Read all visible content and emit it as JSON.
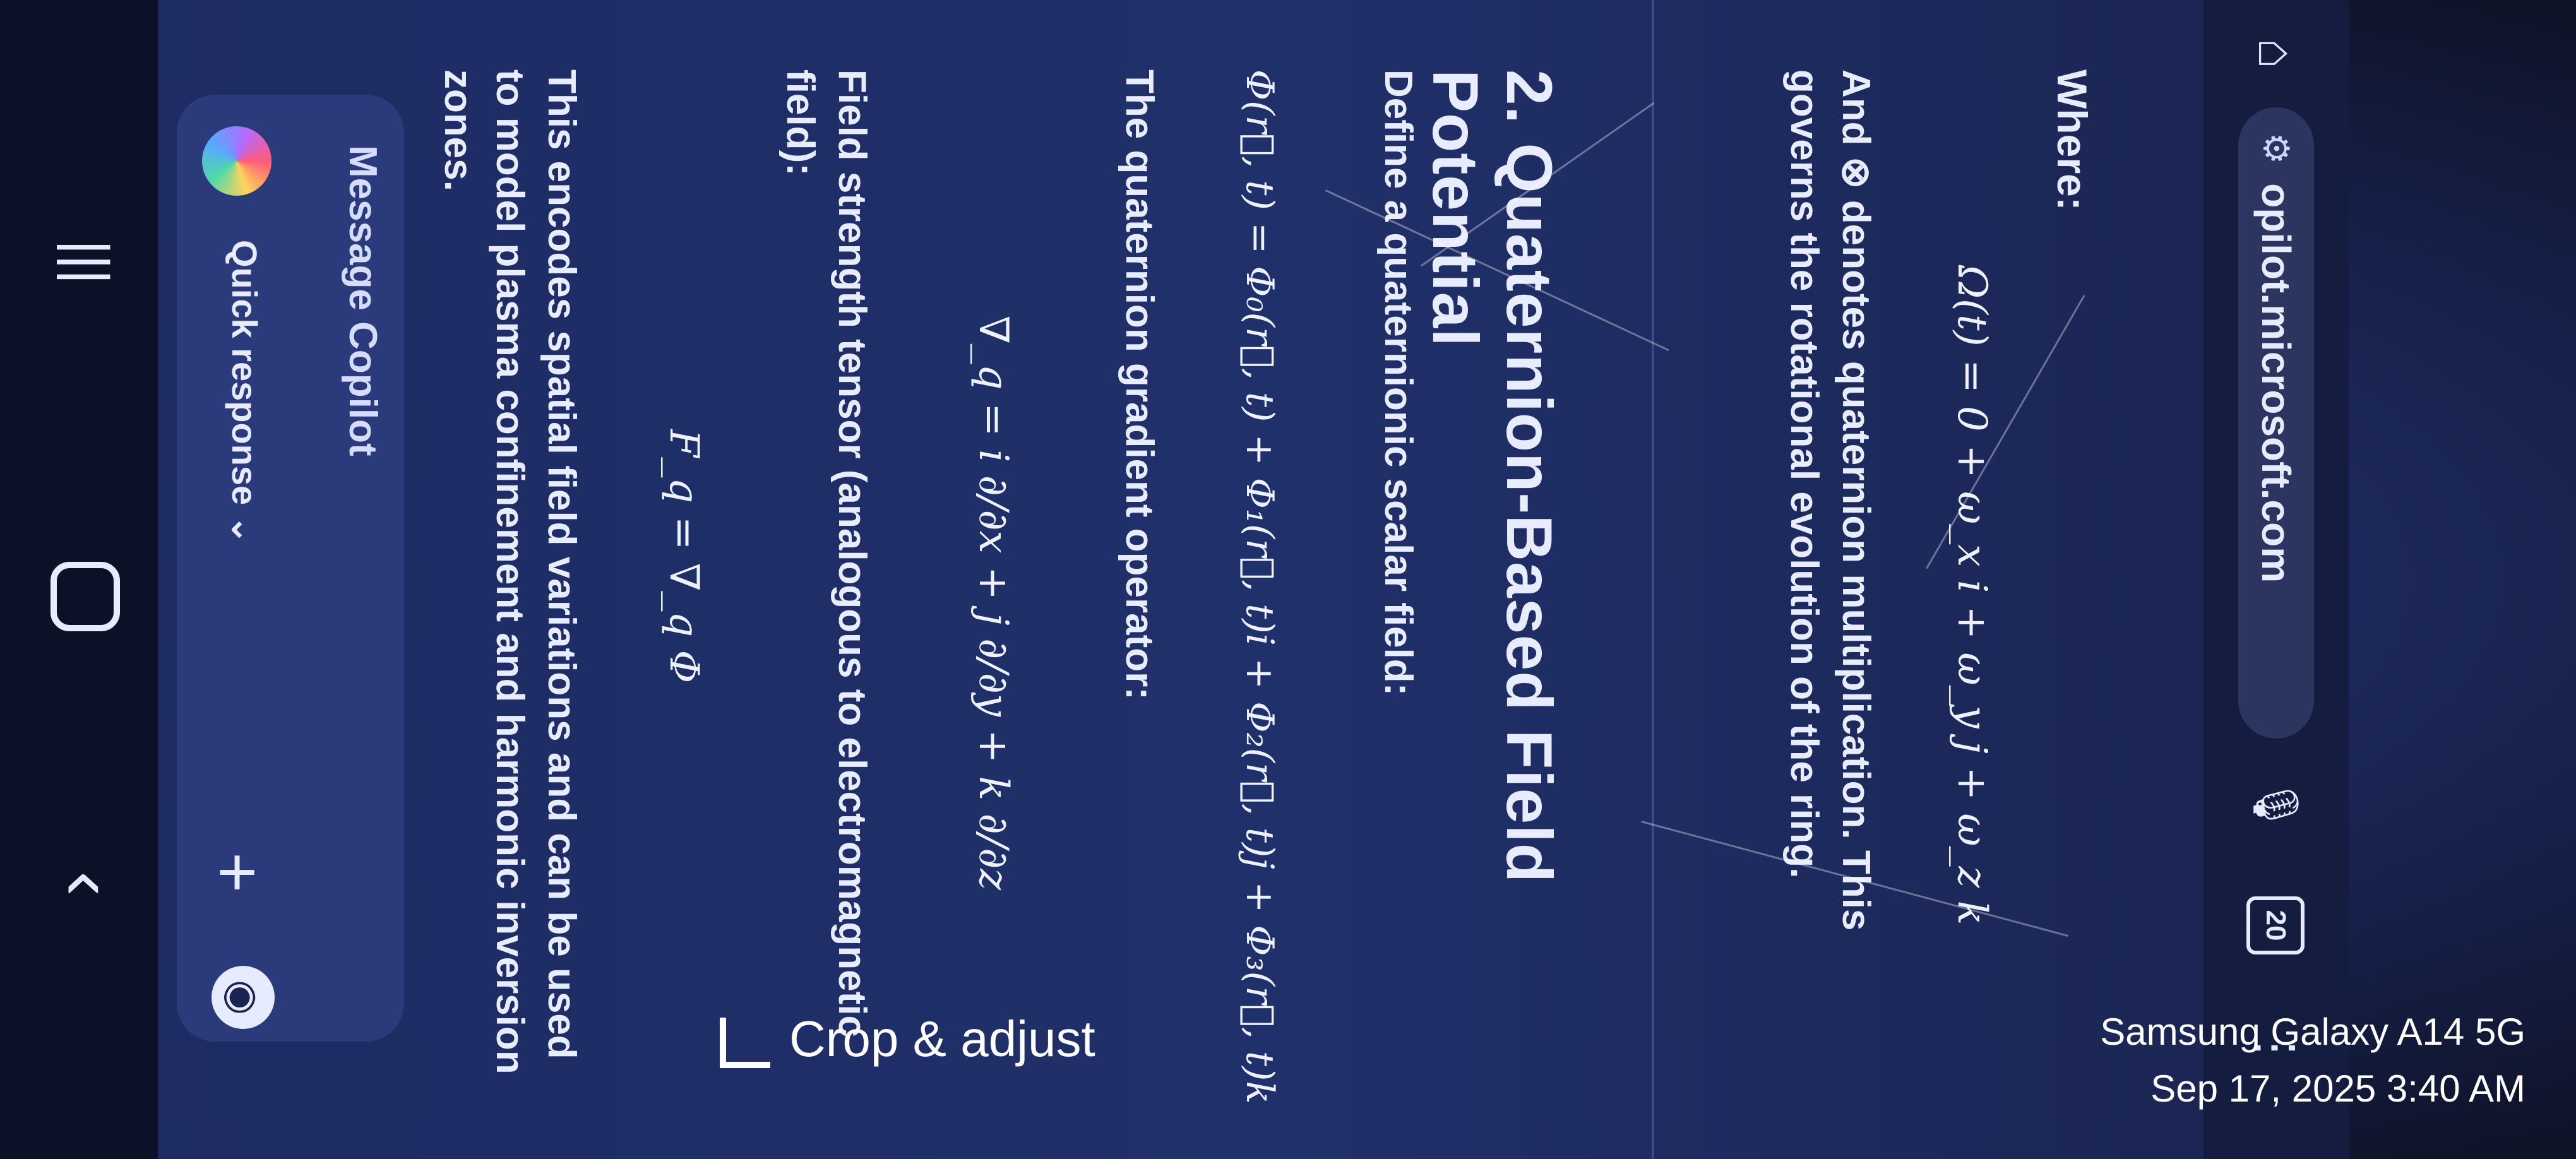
{
  "browser": {
    "url": "opilot.microsoft.com",
    "tab_count": "20"
  },
  "content": {
    "where_label": "Where:",
    "omega_formula": "Ω(t) = 0 + ω_x i + ω_y j + ω_z k",
    "multiplication_note": "And ⊗ denotes quaternion multiplication. This governs the rotational evolution of the ring.",
    "section_heading": "2. Quaternion-Based Field Potential",
    "define_line": "Define a quaternionic scalar field:",
    "phi_formula": "Φ(r⃗, t) = Φ₀(r⃗, t) + Φ₁(r⃗, t)i + Φ₂(r⃗, t)j + Φ₃(r⃗, t)k",
    "gradient_line": "The quaternion gradient operator:",
    "gradient_formula": "∇_q = i ∂/∂x + j ∂/∂y + k ∂/∂z",
    "field_strength_line": "Field strength tensor (analogous to electromagnetic field):",
    "field_formula": "F_q = ∇_q Φ",
    "encodes_line": "This encodes spatial field variations and can be used to model plasma confinement and harmonic inversion zones."
  },
  "composer": {
    "placeholder": "Message Copilot",
    "quick_response": "Quick response"
  },
  "photo_overlay": {
    "crop_label": "Crop & adjust",
    "device": "Samsung Galaxy A14 5G",
    "datetime": "Sep 17, 2025 3:40 AM"
  }
}
